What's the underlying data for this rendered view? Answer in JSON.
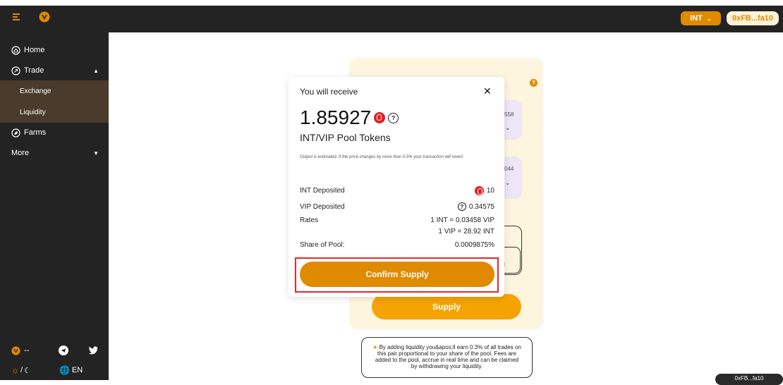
{
  "header": {
    "network_label": "INT",
    "account_label": "0xFB...fa10"
  },
  "sidebar": {
    "items": [
      {
        "label": "Home"
      },
      {
        "label": "Trade"
      },
      {
        "label": "Exchange"
      },
      {
        "label": "Liquidity"
      },
      {
        "label": "Farms"
      },
      {
        "label": "More"
      }
    ],
    "footer": {
      "price": "--",
      "theme_toggle": "/",
      "language": "EN"
    }
  },
  "background_card": {
    "field1_value": "558",
    "field2_value": "044",
    "output_text": "l",
    "supply_label": "Supply"
  },
  "note": "By adding liquidity you&apos;ll earn 0.3% of all trades on this pair proportional to your share of the pool. Fees are added to the pool, accrue in real time and can be claimed by withdrawing your liquidity.",
  "corner_pill": "0xFB...fa10",
  "modal": {
    "title": "You will receive",
    "close": "✕",
    "amount": "1.85927",
    "pool_tokens": "INT/VIP Pool Tokens",
    "estimate_note": "Output is estimated. If the price changes by more than 0.5% your transaction will revert.",
    "rows": [
      {
        "label": "INT Deposited",
        "value": "10"
      },
      {
        "label": "VIP Deposited",
        "value": "0.34575"
      },
      {
        "label": "Rates",
        "value": "1 INT = 0.03458 VIP"
      },
      {
        "label": "Share of Pool:",
        "value": "0.0009875%"
      }
    ],
    "rate2": "1 VIP = 28.92 INT",
    "confirm_label": "Confirm Supply"
  },
  "colors": {
    "accent": "#e08a00",
    "sidebar_bg": "#232323",
    "highlight": "#e8262a",
    "card_bg": "#fdf5de"
  }
}
